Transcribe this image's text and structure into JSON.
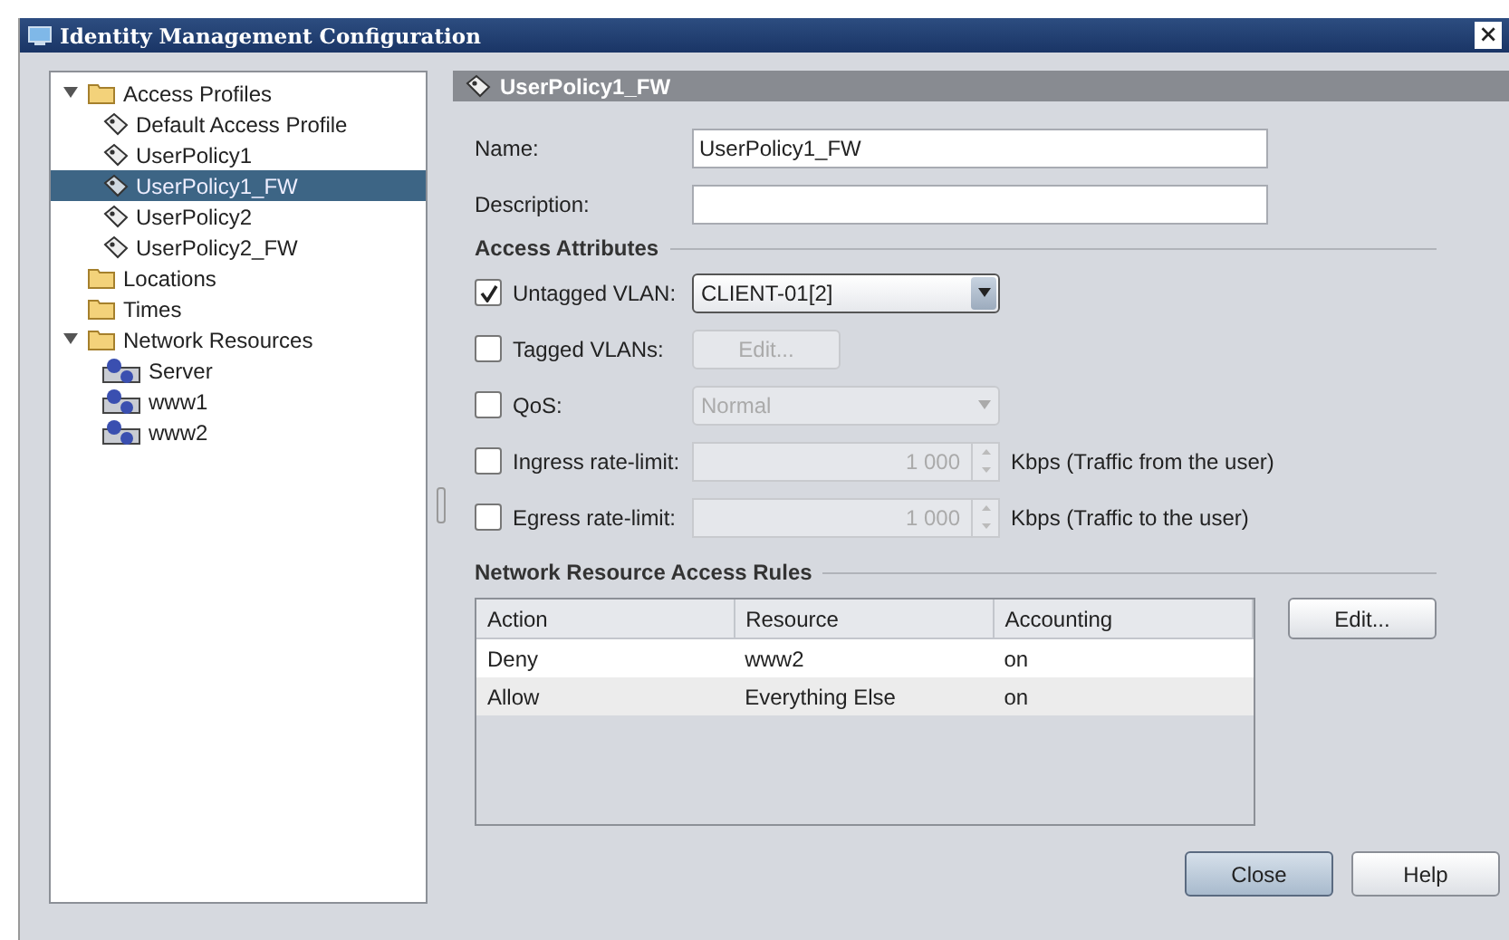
{
  "window": {
    "title": "Identity Management Configuration",
    "close": "×"
  },
  "tree": [
    {
      "label": "Access Profiles",
      "kind": "folder",
      "expanded": true,
      "selected": false,
      "children": [
        {
          "label": "Default Access Profile",
          "kind": "profile",
          "selected": false
        },
        {
          "label": "UserPolicy1",
          "kind": "profile",
          "selected": false
        },
        {
          "label": "UserPolicy1_FW",
          "kind": "profile",
          "selected": true
        },
        {
          "label": "UserPolicy2",
          "kind": "profile",
          "selected": false
        },
        {
          "label": "UserPolicy2_FW",
          "kind": "profile",
          "selected": false
        }
      ]
    },
    {
      "label": "Locations",
      "kind": "folder",
      "selected": false
    },
    {
      "label": "Times",
      "kind": "folder",
      "selected": false
    },
    {
      "label": "Network Resources",
      "kind": "folder",
      "expanded": true,
      "selected": false,
      "children": [
        {
          "label": "Server",
          "kind": "resource",
          "selected": false
        },
        {
          "label": "www1",
          "kind": "resource",
          "selected": false
        },
        {
          "label": "www2",
          "kind": "resource",
          "selected": false
        }
      ]
    }
  ],
  "panel": {
    "title": "UserPolicy1_FW",
    "name": {
      "label": "Name:",
      "value": "UserPolicy1_FW"
    },
    "description": {
      "label": "Description:"
    },
    "access_attributes": {
      "title": "Access Attributes",
      "rows": [
        {
          "label": "Untagged VLAN:",
          "checked": true,
          "kind": "dropdown",
          "value": "CLIENT-01[2]",
          "disabled": false
        },
        {
          "label": "Tagged VLANs:",
          "checked": false,
          "kind": "button",
          "value": "Edit...",
          "disabled": true
        },
        {
          "label": "QoS:",
          "checked": false,
          "kind": "dropdown",
          "value": "Normal",
          "disabled": true
        },
        {
          "label": "Ingress rate-limit:",
          "checked": false,
          "kind": "spinner",
          "value": "1 000",
          "unit": "Kbps (Traffic from the user)",
          "disabled": true
        },
        {
          "label": "Egress rate-limit:",
          "checked": false,
          "kind": "spinner",
          "value": "1 000",
          "unit": "Kbps (Traffic to the user)",
          "disabled": true
        }
      ]
    },
    "rules": {
      "title": "Network Resource Access Rules",
      "columns": [
        "Action",
        "Resource",
        "Accounting"
      ],
      "rows": [
        [
          "Deny",
          "www2",
          "on"
        ],
        [
          "Allow",
          "Everything Else",
          "on"
        ]
      ],
      "edit_button": "Edit..."
    }
  },
  "buttons": [
    {
      "label": "Close",
      "default": true
    },
    {
      "label": "Help",
      "default": false
    }
  ]
}
